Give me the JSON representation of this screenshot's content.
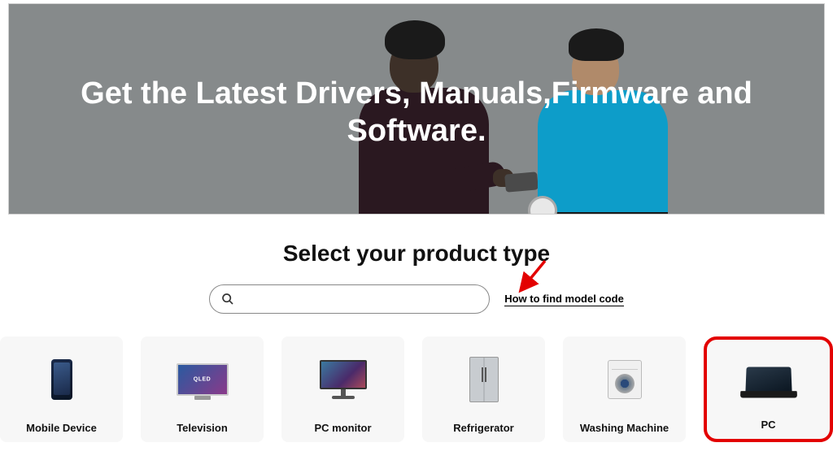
{
  "hero": {
    "title": "Get the Latest Drivers, Manuals,Firmware and Software."
  },
  "section": {
    "title": "Select your product type"
  },
  "search": {
    "placeholder": ""
  },
  "model_link": {
    "label": "How to find model code"
  },
  "tv_badge": "QLED",
  "products": [
    {
      "label": "Mobile Device"
    },
    {
      "label": "Television"
    },
    {
      "label": "PC monitor"
    },
    {
      "label": "Refrigerator"
    },
    {
      "label": "Washing Machine"
    },
    {
      "label": "PC"
    }
  ]
}
